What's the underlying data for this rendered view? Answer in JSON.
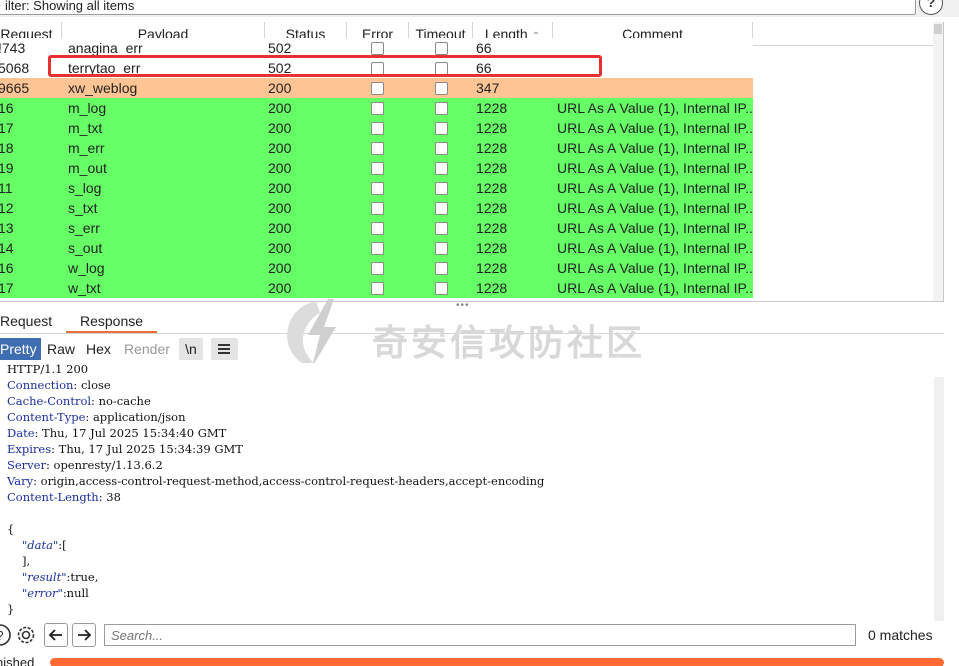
{
  "filter": {
    "text": "ilter: Showing all items"
  },
  "help": {
    "label": "?"
  },
  "table": {
    "columns": [
      {
        "label": "Request"
      },
      {
        "label": "Payload"
      },
      {
        "label": "Status"
      },
      {
        "label": "Error"
      },
      {
        "label": "Timeout"
      },
      {
        "label": "Length"
      },
      {
        "label": "Comment"
      }
    ],
    "sort_indicator": "⌃",
    "rows": [
      {
        "request": "!743",
        "payload": "anagina_err",
        "status": "502",
        "length": "66",
        "comment": "",
        "color": "white"
      },
      {
        "request": "5068",
        "payload": "terrytao_err",
        "status": "502",
        "length": "66",
        "comment": "",
        "color": "white"
      },
      {
        "request": "9665",
        "payload": "xw_weblog",
        "status": "200",
        "length": "347",
        "comment": "",
        "color": "orange"
      },
      {
        "request": "16",
        "payload": "m_log",
        "status": "200",
        "length": "1228",
        "comment": "URL As A Value (1), Internal IP...",
        "color": "green"
      },
      {
        "request": "17",
        "payload": "m_txt",
        "status": "200",
        "length": "1228",
        "comment": "URL As A Value (1), Internal IP...",
        "color": "green"
      },
      {
        "request": "18",
        "payload": "m_err",
        "status": "200",
        "length": "1228",
        "comment": "URL As A Value (1), Internal IP...",
        "color": "green"
      },
      {
        "request": "19",
        "payload": "m_out",
        "status": "200",
        "length": "1228",
        "comment": "URL As A Value (1), Internal IP...",
        "color": "green"
      },
      {
        "request": "11",
        "payload": "s_log",
        "status": "200",
        "length": "1228",
        "comment": "URL As A Value (1), Internal IP...",
        "color": "green"
      },
      {
        "request": "12",
        "payload": "s_txt",
        "status": "200",
        "length": "1228",
        "comment": "URL As A Value (1), Internal IP...",
        "color": "green"
      },
      {
        "request": "13",
        "payload": "s_err",
        "status": "200",
        "length": "1228",
        "comment": "URL As A Value (1), Internal IP...",
        "color": "green"
      },
      {
        "request": "14",
        "payload": "s_out",
        "status": "200",
        "length": "1228",
        "comment": "URL As A Value (1), Internal IP...",
        "color": "green"
      },
      {
        "request": "16",
        "payload": "w_log",
        "status": "200",
        "length": "1228",
        "comment": "URL As A Value (1), Internal IP...",
        "color": "green"
      },
      {
        "request": "17",
        "payload": "w_txt",
        "status": "200",
        "length": "1228",
        "comment": "URL As A Value (1), Internal IP...",
        "color": "green"
      }
    ]
  },
  "splitter": "•••",
  "tabs": {
    "request": "Request",
    "response": "Response"
  },
  "watermark": {
    "text": "奇安信攻防社区"
  },
  "view": {
    "pretty": "Pretty",
    "raw": "Raw",
    "hex": "Hex",
    "render": "Render",
    "newline": "\\n"
  },
  "response": {
    "status_line": "HTTP/1.1 200",
    "headers": [
      {
        "name": "Connection",
        "value": "close"
      },
      {
        "name": "Cache-Control",
        "value": "no-cache"
      },
      {
        "name": "Content-Type",
        "value": "application/json"
      },
      {
        "name": "Date",
        "value": "Thu, 17 Jul 2025 15:34:40 GMT"
      },
      {
        "name": "Expires",
        "value": "Thu, 17 Jul 2025 15:34:39 GMT"
      },
      {
        "name": "Server",
        "value": "openresty/1.13.6.2"
      },
      {
        "name": "Vary",
        "value": "origin,access-control-request-method,access-control-request-headers,accept-encoding"
      },
      {
        "name": "Content-Length",
        "value": "38"
      }
    ],
    "body": {
      "open": "{",
      "data_key": "\"data\"",
      "data_open": ":[",
      "data_close": "],",
      "result_key": "\"result\"",
      "result_val": ":true,",
      "error_key": "\"error\"",
      "error_val": ":null",
      "close": "}"
    }
  },
  "search": {
    "placeholder": "Search...",
    "matches": "0 matches"
  },
  "status": {
    "text": "nished"
  },
  "colors": {
    "green": "#66ff66",
    "orange": "#ffc494",
    "accent": "#e9703a",
    "active_view": "#3f6db1",
    "progress": "#ff6a33"
  }
}
